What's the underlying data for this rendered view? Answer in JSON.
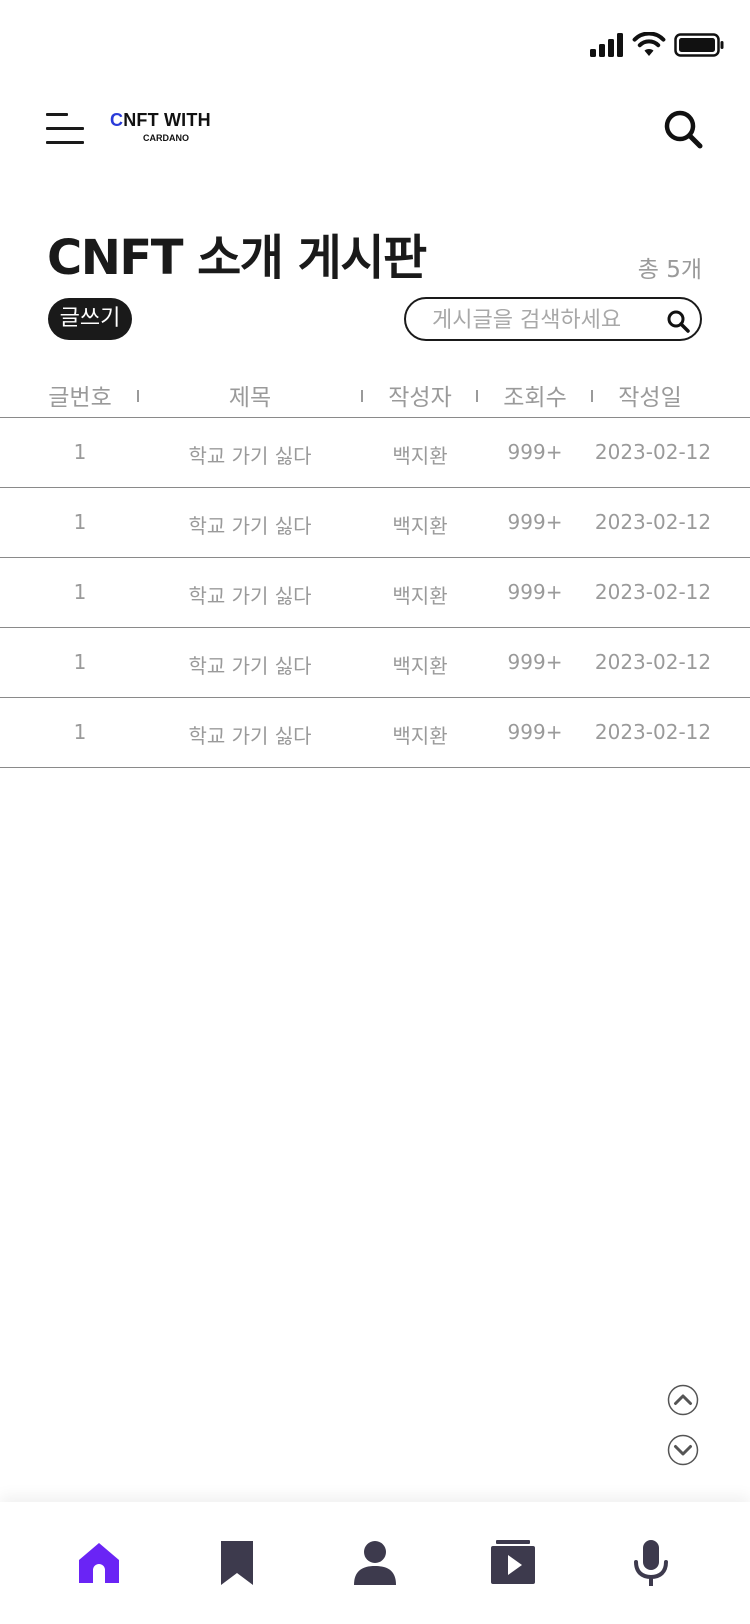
{
  "header": {
    "logo_accent": "C",
    "logo_main": "NFT WITH",
    "logo_sub": "CARDANO"
  },
  "page": {
    "title": "CNFT 소개 게시판",
    "total": "총 5개"
  },
  "actions": {
    "write_label": "글쓰기",
    "search_placeholder": "게시글을 검색하세요"
  },
  "table": {
    "columns": [
      "글번호",
      "제목",
      "작성자",
      "조회수",
      "작성일"
    ],
    "rows": [
      {
        "no": "1",
        "title": "학교 가기 싫다",
        "author": "백지환",
        "views": "999+",
        "date": "2023-02-12"
      },
      {
        "no": "1",
        "title": "학교 가기 싫다",
        "author": "백지환",
        "views": "999+",
        "date": "2023-02-12"
      },
      {
        "no": "1",
        "title": "학교 가기 싫다",
        "author": "백지환",
        "views": "999+",
        "date": "2023-02-12"
      },
      {
        "no": "1",
        "title": "학교 가기 싫다",
        "author": "백지환",
        "views": "999+",
        "date": "2023-02-12"
      },
      {
        "no": "1",
        "title": "학교 가기 싫다",
        "author": "백지환",
        "views": "999+",
        "date": "2023-02-12"
      }
    ]
  },
  "bottom_nav": {
    "items": [
      {
        "icon": "home-icon",
        "active": true
      },
      {
        "icon": "bookmark-icon",
        "active": false
      },
      {
        "icon": "person-icon",
        "active": false
      },
      {
        "icon": "video-icon",
        "active": false
      },
      {
        "icon": "microphone-icon",
        "active": false
      }
    ]
  },
  "colors": {
    "accent": "#6a24f5",
    "inactive_icon": "#3d3a4d",
    "logo_accent": "#2a3bd9",
    "text_muted": "#9a9a9a",
    "dark": "#1a1a1a"
  }
}
